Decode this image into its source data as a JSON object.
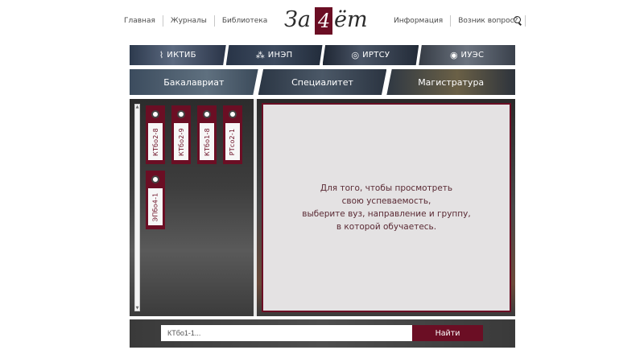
{
  "nav_left": [
    "Главная",
    "Журналы",
    "Библиотека"
  ],
  "nav_right": [
    "Информация",
    "Возник вопрос?"
  ],
  "logo": {
    "part1": "За",
    "part2": "4",
    "part3": "ёт"
  },
  "institutes": [
    {
      "label": "ИКТИБ",
      "icon": "circuit-icon"
    },
    {
      "label": "ИНЭП",
      "icon": "molecule-icon"
    },
    {
      "label": "ИРТСУ",
      "icon": "radar-icon"
    },
    {
      "label": "ИУЭС",
      "icon": "target-icon"
    }
  ],
  "degrees": [
    "Бакалавриат",
    "Специалитет",
    "Магистратура"
  ],
  "groups": [
    "КТбо2-8",
    "КТбо2-9",
    "КТбо1-8",
    "РТсо2-1",
    "ЭПбо4-1"
  ],
  "message": [
    "Для того, чтобы просмотреть",
    "свою успеваемость,",
    "выберите вуз, направление и группу,",
    "в которой обучаетесь."
  ],
  "search": {
    "placeholder": "КТбо1-1...",
    "button": "Найти"
  },
  "colors": {
    "accent": "#6b0e24",
    "panel": "#e4e2e3"
  }
}
